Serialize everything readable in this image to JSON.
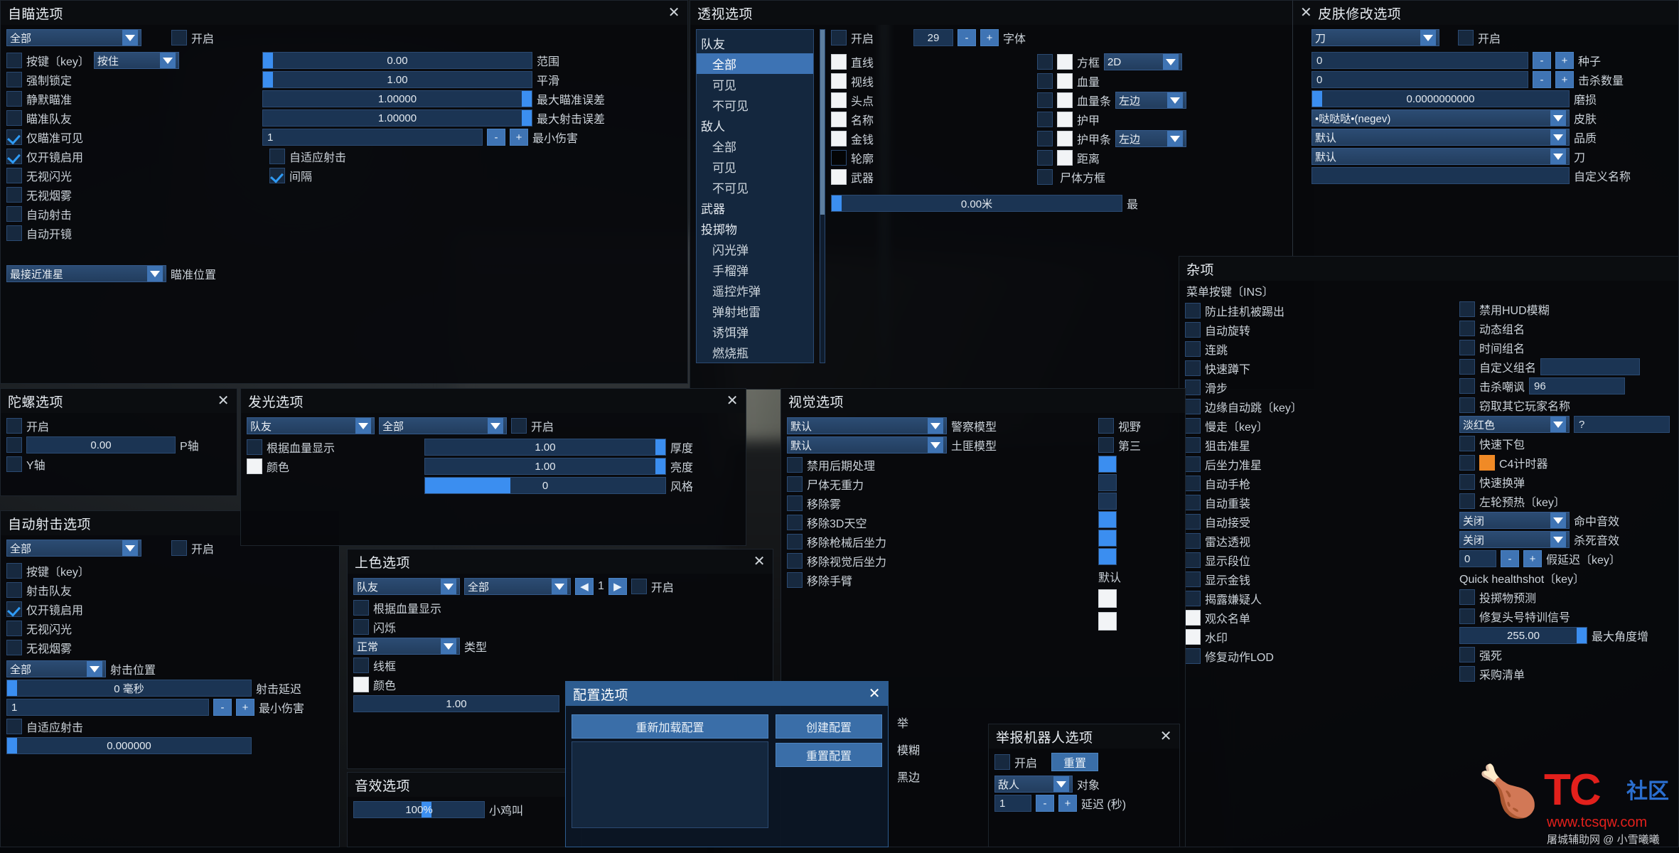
{
  "aimbot": {
    "title": "自瞄选项",
    "close": "✕",
    "weapon_select": "全部",
    "enable_label": "开启",
    "rows": [
      {
        "label": "按键〔key〕",
        "mode": "按住"
      },
      {
        "label": "强制锁定"
      },
      {
        "label": "静默瞄准"
      },
      {
        "label": "瞄准队友"
      },
      {
        "label": "仅瞄准可见",
        "checked": true
      },
      {
        "label": "仅开镜启用",
        "checked": true
      },
      {
        "label": "无视闪光"
      },
      {
        "label": "无视烟雾"
      },
      {
        "label": "自动射击"
      },
      {
        "label": "自动开镜"
      }
    ],
    "sliders": [
      {
        "value": "0.00",
        "label": "范围"
      },
      {
        "value": "1.00",
        "label": "平滑"
      },
      {
        "value": "1.00000",
        "label": "最大瞄准误差"
      },
      {
        "value": "1.00000",
        "label": "最大射击误差"
      }
    ],
    "min_damage": {
      "value": "1",
      "minus": "-",
      "plus": "+",
      "label": "最小伤害"
    },
    "adaptive": "自适应射击",
    "interval": "间隔",
    "aim_position_select": "最接近准星",
    "aim_position_label": "瞄准位置"
  },
  "esp": {
    "title": "透视选项",
    "close": "✕",
    "groups": [
      {
        "header": "队友",
        "items": [
          "全部",
          "可见",
          "不可见"
        ],
        "selected": 0
      },
      {
        "header": "敌人",
        "items": [
          "全部",
          "可见",
          "不可见"
        ]
      },
      {
        "header": "武器",
        "items": []
      },
      {
        "header": "投掷物",
        "items": [
          "闪光弹",
          "手榴弹",
          "遥控炸弹",
          "弹射地雷",
          "诱饵弹",
          "燃烧瓶"
        ]
      }
    ],
    "enable_label": "开启",
    "font_size": "29",
    "minus": "-",
    "plus": "+",
    "font_label": "字体",
    "left_checks": [
      {
        "label": "直线",
        "style": "white"
      },
      {
        "label": "视线",
        "style": "white"
      },
      {
        "label": "头点",
        "style": "white"
      },
      {
        "label": "名称",
        "style": "white"
      },
      {
        "label": "金钱",
        "style": "white"
      },
      {
        "label": "轮廓",
        "style": "black"
      },
      {
        "label": "武器",
        "style": "white"
      }
    ],
    "right_checks": [
      {
        "label": "方框",
        "style": "white",
        "dropdown": "2D"
      },
      {
        "label": "血量",
        "style": "white"
      },
      {
        "label": "血量条",
        "style": "white",
        "dropdown": "左边"
      },
      {
        "label": "护甲",
        "style": "white"
      },
      {
        "label": "护甲条",
        "style": "white",
        "dropdown": "左边"
      },
      {
        "label": "距离",
        "style": "white"
      },
      {
        "label": "尸体方框",
        "style": "dk"
      }
    ],
    "distance": {
      "value": "0.00米",
      "label": "最"
    }
  },
  "skin": {
    "title": "皮肤修改选项",
    "close": "✕",
    "weapon": "刀",
    "enable_label": "开启",
    "seed": {
      "value": "0",
      "minus": "-",
      "plus": "+",
      "label": "种子"
    },
    "stattrak": {
      "value": "0",
      "minus": "-",
      "plus": "+",
      "label": "击杀数量"
    },
    "wear": {
      "value": "0.0000000000",
      "label": "磨损"
    },
    "skin_sel": "•哒哒哒•(negev)",
    "skin_label": "皮肤",
    "quality_sel": "默认",
    "quality_label": "品质",
    "knife_sel": "默认",
    "knife_label": "刀",
    "custom_name_value": "",
    "custom_name_label": "自定义名称"
  },
  "misc": {
    "title": "杂项",
    "menu_key": "菜单按键〔INS〕",
    "left_items": [
      "防止挂机被踢出",
      "自动旋转",
      "连跳",
      "快速蹲下",
      "滑步",
      "边缘自动跳〔key〕",
      "慢走〔key〕",
      "狙击准星",
      "后坐力准星",
      "自动手枪",
      "自动重装",
      "自动接受",
      "雷达透视",
      "显示段位",
      "显示金钱",
      "揭露嫌疑人"
    ],
    "left_white_items": [
      "观众名单",
      "水印"
    ],
    "left_tail": "修复动作LOD",
    "right_items": [
      "禁用HUD模糊",
      "动态组名",
      "时间组名"
    ],
    "custom_group": {
      "label": "自定义组名",
      "value": ""
    },
    "kill_taunt": {
      "label": "击杀嘲讽",
      "value": "96"
    },
    "steal_names": "窃取其它玩家名称",
    "color_sel": "淡红色",
    "color_field": "?",
    "quick_plant": "快速下包",
    "c4_timer": "C4计时器",
    "quick_reload": "快速换弹",
    "revolver": "左轮预热〔key〕",
    "hit_sound": {
      "value": "关闭",
      "label": "命中音效"
    },
    "kill_sound": {
      "value": "关闭",
      "label": "杀死音效"
    },
    "fake_lag": {
      "value": "0",
      "minus": "-",
      "plus": "+",
      "label": "假延迟〔key〕"
    },
    "quick_healthshot": "Quick healthshot〔key〕",
    "nade_predict": "投掷物预测",
    "fix_signal": "修复头号特训信号",
    "max_angle": {
      "value": "255.00",
      "label": "最大角度增"
    },
    "force_tail": "强死",
    "tail2": "采购清单"
  },
  "gyro": {
    "title": "陀螺选项",
    "close": "✕",
    "enable": "开启",
    "value": "0.00",
    "p_label": "P轴",
    "y_label": "Y轴"
  },
  "autofire": {
    "title": "自动射击选项",
    "weapon_select": "全部",
    "enable_label": "开启",
    "items": [
      {
        "label": "按键〔key〕"
      },
      {
        "label": "射击队友"
      },
      {
        "label": "仅开镜启用",
        "checked": true
      },
      {
        "label": "无视闪光"
      },
      {
        "label": "无视烟雾"
      }
    ],
    "hit_pos_sel": "全部",
    "hit_pos_label": "射击位置",
    "delay": {
      "value": "0 毫秒",
      "label": "射击延迟"
    },
    "min_damage": {
      "value": "1",
      "minus": "-",
      "plus": "+",
      "label": "最小伤害"
    },
    "adaptive": "自适应射击",
    "bottom_value": "0.000000"
  },
  "glow": {
    "title": "发光选项",
    "close": "✕",
    "team_sel": "队友",
    "scope_sel": "全部",
    "enable": "开启",
    "by_health": "根据血量显示",
    "color": "颜色",
    "sliders": [
      {
        "value": "1.00",
        "label": "厚度"
      },
      {
        "value": "1.00",
        "label": "亮度"
      },
      {
        "value": "0",
        "label": "风格"
      }
    ]
  },
  "chams": {
    "title": "上色选项",
    "close": "✕",
    "team_sel": "队友",
    "scope_sel": "全部",
    "prev": "◀",
    "index": "1",
    "next": "▶",
    "enable": "开启",
    "by_health": "根据血量显示",
    "blink": "闪烁",
    "type_sel": "正常",
    "type_label": "类型",
    "wireframe": "线框",
    "color": "颜色",
    "alpha": "1.00"
  },
  "sound": {
    "title": "音效选项",
    "value": "100%",
    "label": "小鸡叫"
  },
  "visual": {
    "title": "视觉选项",
    "ct_model_sel": "默认",
    "ct_model_label": "警察模型",
    "t_model_sel": "默认",
    "t_model_label": "土匪模型",
    "items": [
      "禁用后期处理",
      "尸体无重力",
      "移除雾",
      "移除3D天空",
      "移除枪械后坐力",
      "移除视觉后坐力",
      "移除手臂"
    ],
    "right_items": [
      "视野",
      "第三"
    ],
    "right_default": "默认"
  },
  "config": {
    "title": "配置选项",
    "close": "✕",
    "reload": "重新加载配置",
    "create": "创建配置",
    "reset": "重置配置",
    "side_labels": [
      "举",
      "模糊",
      "黑边"
    ]
  },
  "reportbot": {
    "title": "举报机器人选项",
    "close": "✕",
    "enable": "开启",
    "reset": "重置",
    "target_sel": "敌人",
    "target_label": "对象",
    "delay": {
      "value": "1",
      "minus": "-",
      "plus": "+",
      "label": "延迟 (秒)"
    }
  },
  "watermark": {
    "brand": "TC",
    "community": "社区",
    "url": "www.tcsqw.com",
    "sub": "屠城辅助网 @ 小雪曦曦",
    "mascot": "🍗"
  }
}
